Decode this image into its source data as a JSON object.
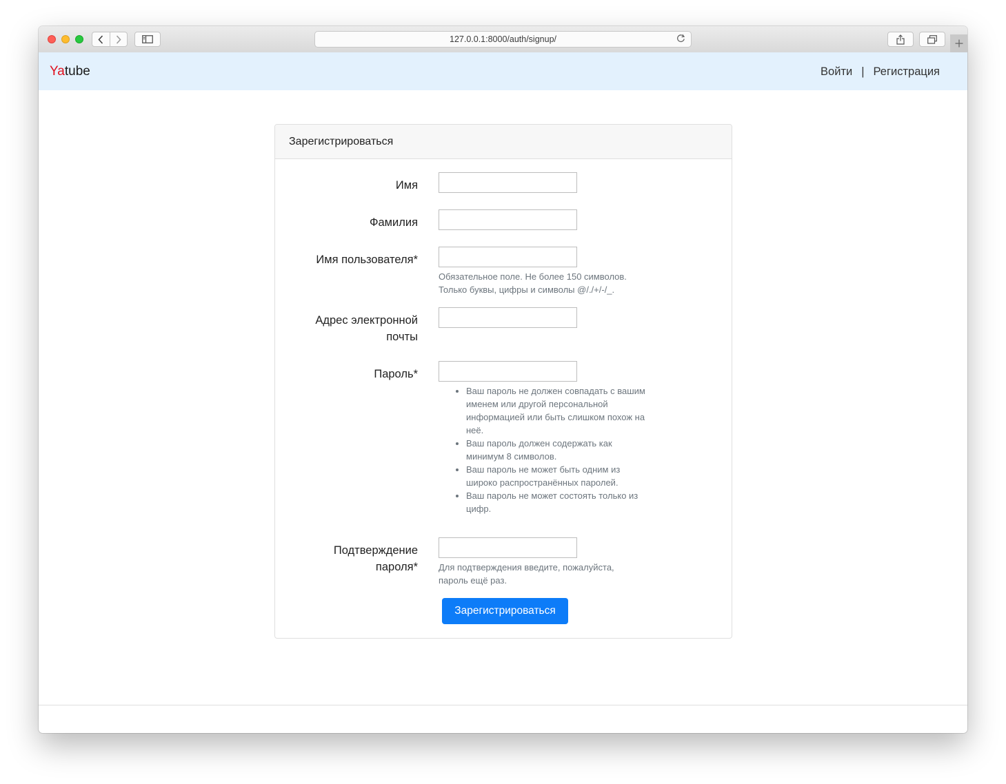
{
  "browser": {
    "url": "127.0.0.1:8000/auth/signup/"
  },
  "site": {
    "brand_prefix": "Ya",
    "brand_suffix": "tube",
    "brand_prefix_color": "#e0101e",
    "navbar_color": "#e3f1fd",
    "nav": {
      "login": "Войти",
      "separator": "|",
      "signup": "Регистрация"
    }
  },
  "form": {
    "title": "Зарегистрироваться",
    "fields": {
      "first_name": {
        "label": "Имя",
        "value": ""
      },
      "last_name": {
        "label": "Фамилия",
        "value": ""
      },
      "username": {
        "label": "Имя пользователя*",
        "value": "",
        "help_line1": "Обязательное поле. Не более 150 символов.",
        "help_line2": "Только буквы, цифры и символы @/./+/-/_."
      },
      "email": {
        "label_line1": "Адрес электронной",
        "label_line2": "почты",
        "value": ""
      },
      "password1": {
        "label": "Пароль*",
        "value": "",
        "help_items": [
          "Ваш пароль не должен совпадать с вашим именем или другой персональной информацией или быть слишком похож на неё.",
          "Ваш пароль должен содержать как минимум 8 символов.",
          "Ваш пароль не может быть одним из широко распространённых паролей.",
          "Ваш пароль не может состоять только из цифр."
        ]
      },
      "password2": {
        "label_line1": "Подтверждение",
        "label_line2": "пароля*",
        "value": "",
        "help_line1": "Для подтверждения введите, пожалуйста,",
        "help_line2": "пароль ещё раз."
      }
    },
    "submit_label": "Зарегистрироваться",
    "submit_color": "#0d7cf8"
  },
  "icons": {
    "close": "close-icon",
    "minimize": "minimize-icon",
    "zoom": "zoom-icon",
    "back": "chevron-left-icon",
    "forward": "chevron-right-icon",
    "sidebar": "sidebar-icon",
    "reload": "reload-icon",
    "share": "share-icon",
    "tabs": "tabs-overview-icon",
    "new_tab": "plus-icon"
  }
}
